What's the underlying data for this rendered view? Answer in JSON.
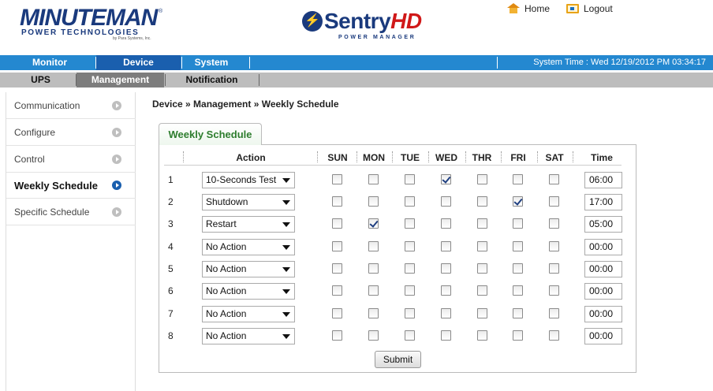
{
  "header": {
    "brand_big": "MINUTEMAN",
    "brand_sub": "POWER TECHNOLOGIES",
    "brand_tiny": "by Para Systems, Inc.",
    "product_name": "Sentry",
    "product_suffix": "HD",
    "product_sub": "POWER MANAGER",
    "home_label": "Home",
    "logout_label": "Logout"
  },
  "nav1": {
    "items": [
      {
        "label": "Monitor",
        "active": false
      },
      {
        "label": "Device",
        "active": true
      },
      {
        "label": "System",
        "active": false
      }
    ],
    "system_time": "System Time : Wed 12/19/2012 PM 03:34:17"
  },
  "nav2": {
    "items": [
      {
        "label": "UPS",
        "active": false
      },
      {
        "label": "Management",
        "active": true
      },
      {
        "label": "Notification",
        "active": false
      }
    ]
  },
  "sidebar": {
    "items": [
      {
        "label": "Communication",
        "active": false
      },
      {
        "label": "Configure",
        "active": false
      },
      {
        "label": "Control",
        "active": false
      },
      {
        "label": "Weekly Schedule",
        "active": true
      },
      {
        "label": "Specific Schedule",
        "active": false
      }
    ]
  },
  "main": {
    "breadcrumb": "Device » Management » Weekly Schedule",
    "tab_label": "Weekly Schedule",
    "columns": {
      "action": "Action",
      "days": [
        "SUN",
        "MON",
        "TUE",
        "WED",
        "THR",
        "FRI",
        "SAT"
      ],
      "time": "Time"
    },
    "rows": [
      {
        "num": "1",
        "action": "10-Seconds Test",
        "days": [
          false,
          false,
          false,
          true,
          false,
          false,
          false
        ],
        "time": "06:00"
      },
      {
        "num": "2",
        "action": "Shutdown",
        "days": [
          false,
          false,
          false,
          false,
          false,
          true,
          false
        ],
        "time": "17:00"
      },
      {
        "num": "3",
        "action": "Restart",
        "days": [
          false,
          true,
          false,
          false,
          false,
          false,
          false
        ],
        "time": "05:00"
      },
      {
        "num": "4",
        "action": "No Action",
        "days": [
          false,
          false,
          false,
          false,
          false,
          false,
          false
        ],
        "time": "00:00"
      },
      {
        "num": "5",
        "action": "No Action",
        "days": [
          false,
          false,
          false,
          false,
          false,
          false,
          false
        ],
        "time": "00:00"
      },
      {
        "num": "6",
        "action": "No Action",
        "days": [
          false,
          false,
          false,
          false,
          false,
          false,
          false
        ],
        "time": "00:00"
      },
      {
        "num": "7",
        "action": "No Action",
        "days": [
          false,
          false,
          false,
          false,
          false,
          false,
          false
        ],
        "time": "00:00"
      },
      {
        "num": "8",
        "action": "No Action",
        "days": [
          false,
          false,
          false,
          false,
          false,
          false,
          false
        ],
        "time": "00:00"
      }
    ],
    "submit_label": "Submit"
  },
  "colors": {
    "nav1_bg": "#2488d0",
    "nav1_active": "#1a5fae",
    "nav2_bg": "#bdbdbd",
    "nav2_active": "#7d7d7d",
    "brand_blue": "#1a3a7d",
    "brand_red": "#d01818",
    "tab_green": "#2e7d2e"
  }
}
